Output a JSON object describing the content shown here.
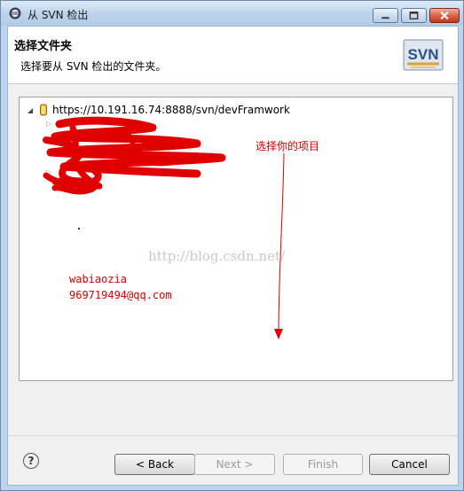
{
  "window": {
    "title": "从 SVN 检出"
  },
  "header": {
    "title": "选择文件夹",
    "description": "选择要从 SVN 检出的文件夹。",
    "logo_text": "SVN"
  },
  "tree": {
    "root": {
      "url": "https://10.191.16.74:8888/svn/devFramwork",
      "icon": "repository-icon",
      "expanded": true
    }
  },
  "annotations": {
    "arrow_label": "选择你的项目",
    "dot": ".",
    "watermark": "http://blog.csdn.net/",
    "signature_name": "wabiaozia",
    "signature_email": "969719494@qq.com",
    "ink_color": "#e00000"
  },
  "buttons": {
    "back": "< Back",
    "next": "Next >",
    "finish": "Finish",
    "cancel": "Cancel"
  },
  "icons": {
    "help": "?"
  }
}
